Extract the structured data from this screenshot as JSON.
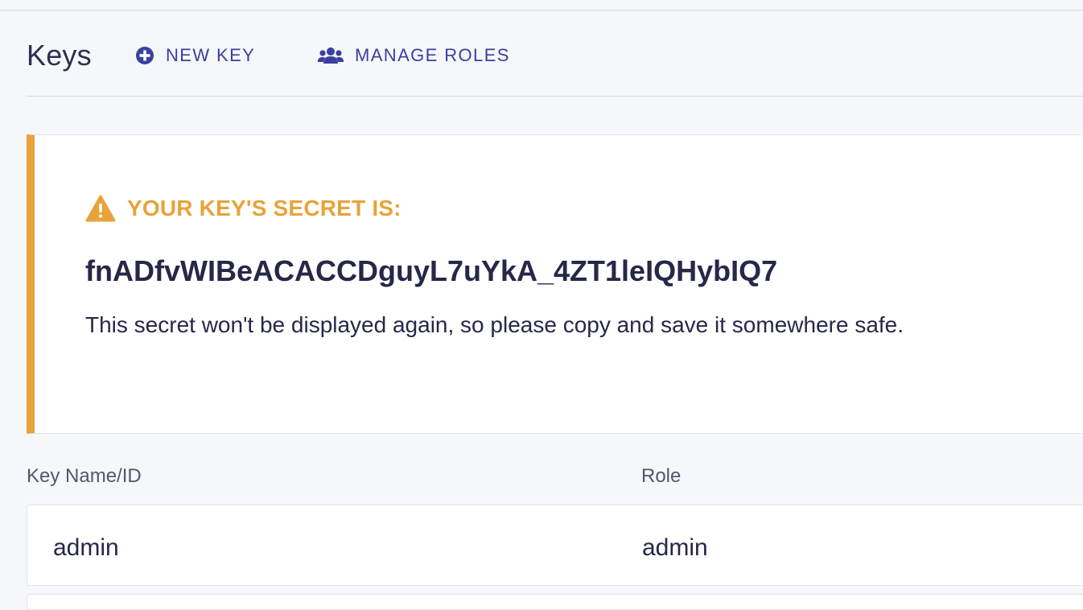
{
  "header": {
    "title": "Keys",
    "actions": [
      {
        "label": "NEW KEY",
        "icon": "plus-circle-icon"
      },
      {
        "label": "MANAGE ROLES",
        "icon": "users-icon"
      }
    ]
  },
  "alert": {
    "icon": "warning-triangle-icon",
    "heading": "YOUR KEY'S SECRET IS:",
    "secret": "fnADfvWIBeACACCDguyL7uYkA_4ZT1leIQHybIQ7",
    "note": "This secret won't be displayed again, so please copy and save it somewhere safe."
  },
  "table": {
    "columns": [
      "Key Name/ID",
      "Role"
    ],
    "rows": [
      {
        "name": "admin",
        "role": "admin"
      }
    ]
  },
  "colors": {
    "accent": "#3b3fa0",
    "warning": "#e8a33a",
    "text": "#252848",
    "background": "#f6f7fa"
  }
}
